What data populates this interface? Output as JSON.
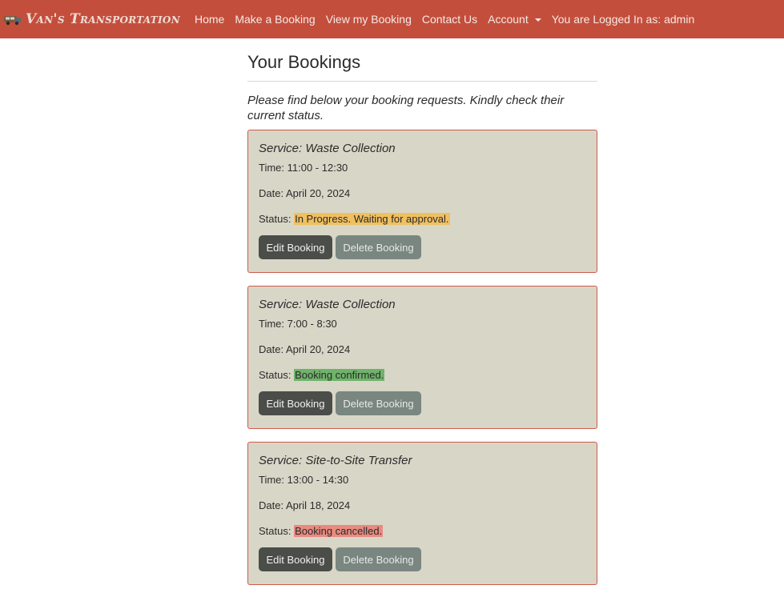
{
  "nav": {
    "brand": "Van's Transportation",
    "links": [
      "Home",
      "Make a Booking",
      "View my Booking",
      "Contact Us"
    ],
    "account": "Account",
    "logged_in": "You are Logged In as: admin"
  },
  "page": {
    "title": "Your Bookings",
    "intro": "Please find below your booking requests. Kindly check their current status."
  },
  "bookings": [
    {
      "service": "Service: Waste Collection",
      "time": "Time: 11:00 - 12:30",
      "date": "Date: April 20, 2024",
      "status_label": "Status:",
      "status": "In Progress. Waiting for approval.",
      "status_color": "#f0c060",
      "edit_label": "Edit Booking",
      "delete_label": "Delete Booking"
    },
    {
      "service": "Service: Waste Collection",
      "time": "Time: 7:00 - 8:30",
      "date": "Date: April 20, 2024",
      "status_label": "Status:",
      "status": "Booking confirmed.",
      "status_color": "#6fb36a",
      "edit_label": "Edit Booking",
      "delete_label": "Delete Booking"
    },
    {
      "service": "Service: Site-to-Site Transfer",
      "time": "Time: 13:00 - 14:30",
      "date": "Date: April 18, 2024",
      "status_label": "Status:",
      "status": "Booking cancelled.",
      "status_color": "#e88a80",
      "edit_label": "Edit Booking",
      "delete_label": "Delete Booking"
    }
  ],
  "colors": {
    "navbar": "#c44e3c",
    "card_bg": "#d8d6c7",
    "card_border": "#cf5a4a",
    "edit_button": "#4b4d49",
    "delete_button": "#7a8680"
  },
  "icons": {
    "brand_logo": "van-icon"
  }
}
